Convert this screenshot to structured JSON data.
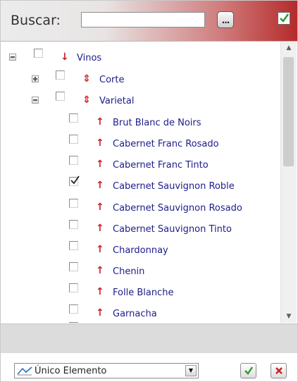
{
  "header": {
    "search_label": "Buscar:",
    "search_value": "",
    "search_button_label": "...",
    "select_all_icon": "check-all-icon"
  },
  "tree": {
    "root": {
      "label": "Vinos",
      "expanded": true,
      "checked": false,
      "arrow": "down"
    },
    "groups": [
      {
        "label": "Corte",
        "expanded": false,
        "checked": false,
        "arrow": "updown"
      },
      {
        "label": "Varietal",
        "expanded": true,
        "checked": false,
        "arrow": "updown"
      }
    ],
    "varietal_items": [
      {
        "label": "Brut Blanc de Noirs",
        "checked": false
      },
      {
        "label": "Cabernet Franc Rosado",
        "checked": false
      },
      {
        "label": "Cabernet Franc Tinto",
        "checked": false
      },
      {
        "label": "Cabernet Sauvignon Roble",
        "checked": true
      },
      {
        "label": "Cabernet Sauvignon Rosado",
        "checked": false
      },
      {
        "label": "Cabernet Sauvignon Tinto",
        "checked": false
      },
      {
        "label": "Chardonnay",
        "checked": false
      },
      {
        "label": "Chenin",
        "checked": false
      },
      {
        "label": "Folle Blanche",
        "checked": false
      },
      {
        "label": "Garnacha",
        "checked": false
      }
    ]
  },
  "scrollbar": {
    "position_fraction": 0.0
  },
  "footer": {
    "mode_value": "Único Elemento",
    "mode_icon": "chart-line-icon",
    "accept_icon": "check-icon",
    "cancel_icon": "close-icon"
  },
  "colors": {
    "header_accent": "#b52a2a",
    "arrow": "#cc1f1f",
    "label": "#1c1c8a",
    "accept": "#2e9a2e",
    "cancel": "#cc1f1f"
  }
}
